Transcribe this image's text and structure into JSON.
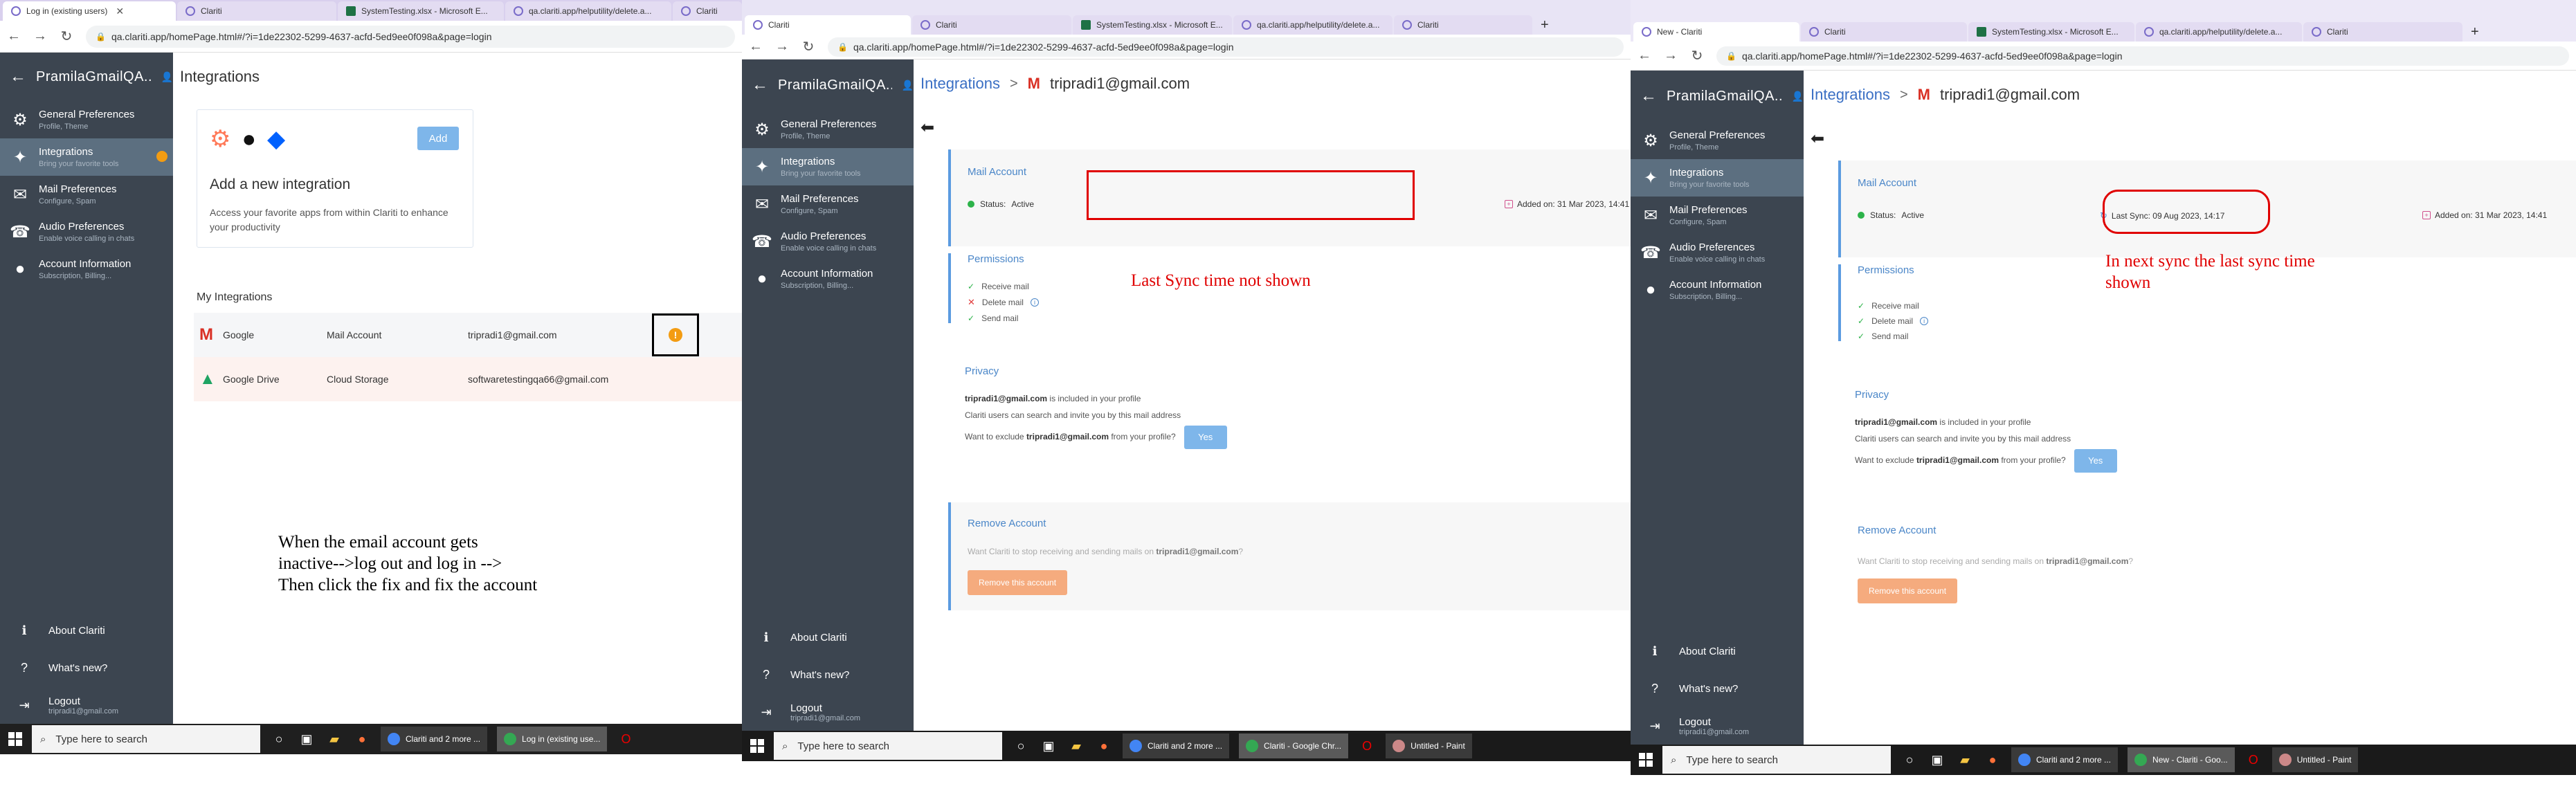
{
  "panel1": {
    "tabs": [
      "Log in (existing users)",
      "Clariti",
      "SystemTesting.xlsx - Microsoft E...",
      "qa.clariti.app/helputility/delete.a...",
      "Clariti"
    ],
    "url": "qa.clariti.app/homePage.html#/?i=1de22302-5299-4637-acfd-5ed9ee0f098a&page=login",
    "user": "PramilaGmailQA...",
    "page_title": "Integrations",
    "sidebar": [
      {
        "title": "General Preferences",
        "sub": "Profile, Theme"
      },
      {
        "title": "Integrations",
        "sub": "Bring your favorite tools"
      },
      {
        "title": "Mail Preferences",
        "sub": "Configure, Spam"
      },
      {
        "title": "Audio Preferences",
        "sub": "Enable voice calling in chats"
      },
      {
        "title": "Account Information",
        "sub": "Subscription, Billing..."
      }
    ],
    "sidebar_bottom": {
      "about": "About Clariti",
      "whatsnew": "What's new?",
      "logout": "Logout",
      "logout_email": "tripradi1@gmail.com"
    },
    "add_card": {
      "add": "Add",
      "title": "Add a new integration",
      "desc": "Access your favorite apps from within Clariti to enhance your productivity"
    },
    "my_integrations": "My Integrations",
    "rows": [
      {
        "app": "Google",
        "type": "Mail Account",
        "email": "tripradi1@gmail.com"
      },
      {
        "app": "Google Drive",
        "type": "Cloud Storage",
        "email": "softwaretestingqa66@gmail.com"
      }
    ],
    "annotation": [
      "When the email account gets",
      "inactive-->log out and log in -->",
      "Then click the fix and fix the  account"
    ],
    "taskbar": {
      "search": "Type here to search",
      "apps": [
        "Clariti and 2 more ...",
        "Log in (existing use..."
      ]
    }
  },
  "panel2": {
    "tabs": [
      "Clariti",
      "Clariti",
      "SystemTesting.xlsx - Microsoft E...",
      "qa.clariti.app/helputility/delete.a...",
      "Clariti"
    ],
    "url": "qa.clariti.app/homePage.html#/?i=1de22302-5299-4637-acfd-5ed9ee0f098a&page=login",
    "user": "PramilaGmailQA...",
    "crumb_root": "Integrations",
    "crumb_email": "tripradi1@gmail.com",
    "mail_account": "Mail Account",
    "status_label": "Status:",
    "status_value": "Active",
    "added": "Added on:  31 Mar 2023, 14:41",
    "permissions": "Permissions",
    "perm_items": [
      "Receive mail",
      "Delete mail",
      "Send mail"
    ],
    "privacy": "Privacy",
    "privacy_l1_email": "tripradi1@gmail.com",
    "privacy_l1_rest": " is included in your profile",
    "privacy_l2": "Clariti users can search and invite you by this mail address",
    "privacy_l3_pre": "Want to exclude ",
    "privacy_l3_email": "tripradi1@gmail.com",
    "privacy_l3_post": " from your profile?",
    "yes": "Yes",
    "remove_title": "Remove Account",
    "remove_text_pre": "Want Clariti to stop receiving and sending mails on ",
    "remove_text_email": "tripradi1@gmail.com",
    "remove_text_post": "?",
    "remove_btn": "Remove this account",
    "annotation": "Last Sync time not shown",
    "taskbar": {
      "search": "Type here to search",
      "apps": [
        "Clariti and 2 more ...",
        "Clariti - Google Chr...",
        "Untitled - Paint"
      ]
    }
  },
  "panel3": {
    "tabs": [
      "New - Clariti",
      "Clariti",
      "SystemTesting.xlsx - Microsoft E...",
      "qa.clariti.app/helputility/delete.a...",
      "Clariti"
    ],
    "url": "qa.clariti.app/homePage.html#/?i=1de22302-5299-4637-acfd-5ed9ee0f098a&page=login",
    "user": "PramilaGmailQA...",
    "crumb_root": "Integrations",
    "crumb_email": "tripradi1@gmail.com",
    "mail_account": "Mail Account",
    "status_label": "Status:",
    "status_value": "Active",
    "last_sync": "Last Sync:  09 Aug 2023, 14:17",
    "added": "Added on:  31 Mar 2023, 14:41",
    "permissions": "Permissions",
    "perm_items": [
      "Receive mail",
      "Delete mail",
      "Send mail"
    ],
    "privacy": "Privacy",
    "privacy_l1_email": "tripradi1@gmail.com",
    "privacy_l1_rest": " is included in your profile",
    "privacy_l2": "Clariti users can search and invite you by this mail address",
    "privacy_l3_pre": "Want to exclude ",
    "privacy_l3_email": "tripradi1@gmail.com",
    "privacy_l3_post": " from your profile?",
    "yes": "Yes",
    "remove_title": "Remove Account",
    "remove_text_pre": "Want Clariti to stop receiving and sending mails on ",
    "remove_text_email": "tripradi1@gmail.com",
    "remove_text_post": "?",
    "remove_btn": "Remove this account",
    "annotation": [
      "In next sync the last sync time",
      "shown"
    ],
    "taskbar": {
      "search": "Type here to search",
      "apps": [
        "Clariti and 2 more ...",
        "New - Clariti - Goo...",
        "Untitled - Paint"
      ]
    }
  }
}
